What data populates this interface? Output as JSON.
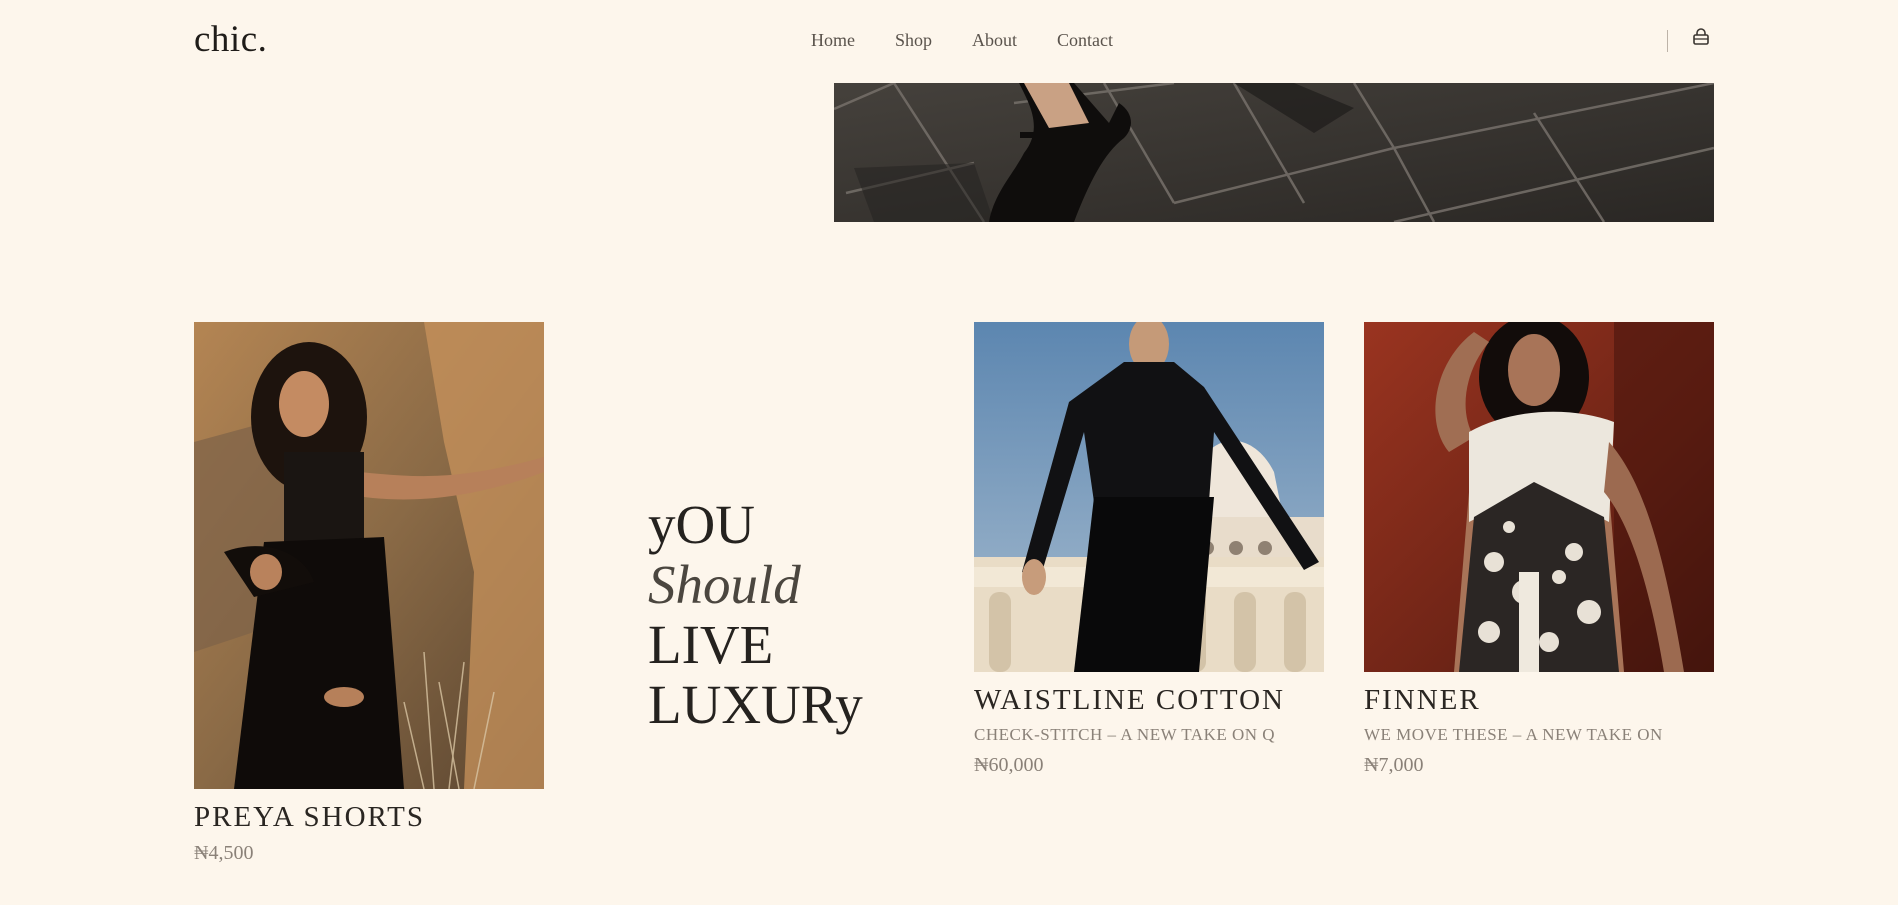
{
  "header": {
    "logo": "chic.",
    "nav": [
      "Home",
      "Shop",
      "About",
      "Contact"
    ],
    "cart_icon": "shopping-bag-icon"
  },
  "tagline": {
    "line1": "yOU",
    "line2": "Should",
    "line3": "LIVE",
    "line4": "LUXURy"
  },
  "products": [
    {
      "title": "PREYA SHORTS",
      "subtitle": "",
      "price": "₦4,500"
    },
    {
      "title": "WAISTLINE COTTON",
      "subtitle": "CHECK-STITCH – A NEW TAKE ON Q",
      "price": "₦60,000"
    },
    {
      "title": "FINNER",
      "subtitle": "WE MOVE THESE – A NEW TAKE ON",
      "price": "₦7,000"
    }
  ],
  "colors": {
    "background": "#fdf6ec",
    "text": "#2a2622",
    "muted": "#8a8178"
  }
}
